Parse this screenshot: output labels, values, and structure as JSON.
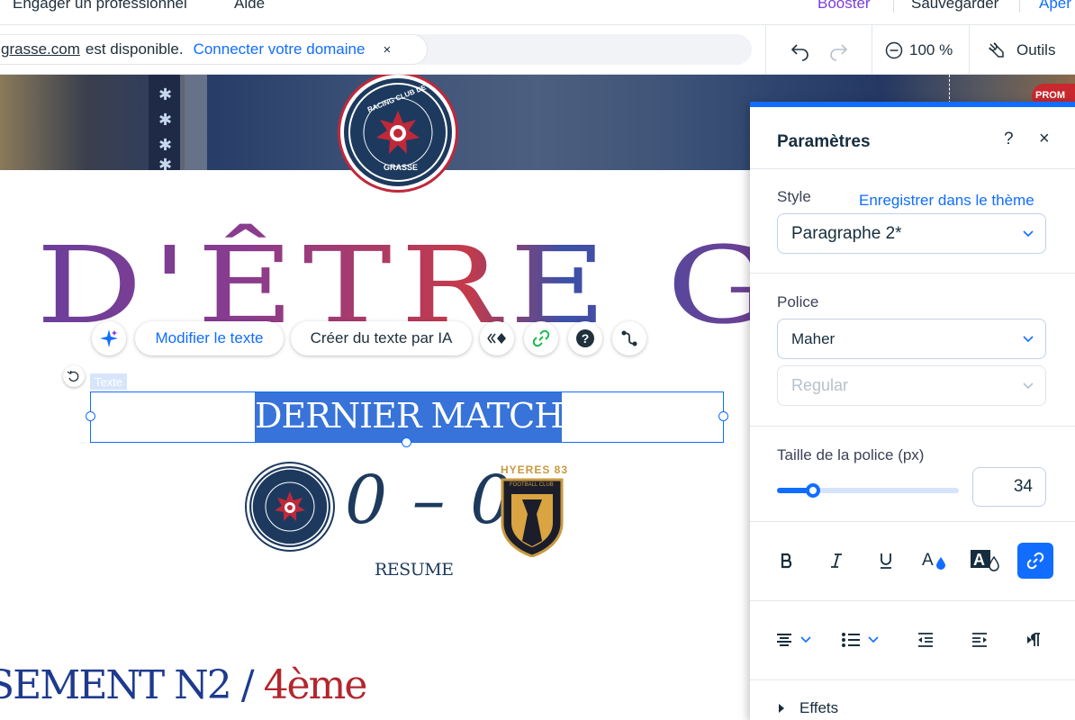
{
  "topbar": {
    "engager": "Engager un professionnel",
    "aide": "Aide",
    "booster": "Booster",
    "sauvegarder": "Sauvegarder",
    "apercu": "Aper"
  },
  "domain_bar": {
    "domain": "grasse.com",
    "available": "est disponible.",
    "connect": "Connecter votre domaine",
    "close": "×"
  },
  "tools": {
    "zoom": "100 %",
    "outils": "Outils"
  },
  "canvas": {
    "club_logo_text_top": "RACING CLUB DE",
    "club_logo_text_bottom": "GRASSE",
    "big_title": "D'ÊTRE GRA",
    "ai_toolbar": {
      "modify": "Modifier le texte",
      "create": "Créer du texte par IA"
    },
    "element_tag": "Texte",
    "selected_text": "DERNIER MATCH",
    "score": "0 – 0",
    "away_team": "HYERES 83",
    "away_team_sub": "FOOTBALL CLUB",
    "resume": "RESUME",
    "classement_a": "SEMENT N2",
    "classement_sep": " / ",
    "classement_b": "4ème",
    "badge_partial": "PROM"
  },
  "panel": {
    "title": "Paramètres",
    "help": "?",
    "close": "×",
    "style_label": "Style",
    "save_theme": "Enregistrer dans le thème",
    "style_value": "Paragraphe 2*",
    "police_label": "Police",
    "font_value": "Maher",
    "weight_value": "Regular",
    "size_label": "Taille de la police (px)",
    "size_value": "34",
    "size_fraction": 0.2,
    "effets": "Effets"
  },
  "colors": {
    "accent": "#116dff",
    "navy": "#1d3a5e",
    "red": "#b3262e"
  }
}
